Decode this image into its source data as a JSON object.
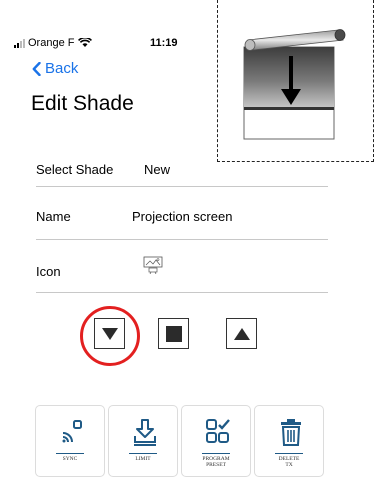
{
  "status_bar": {
    "carrier": "Orange F",
    "time": "11:19"
  },
  "nav": {
    "back_label": "Back"
  },
  "page_title": "Edit Shade",
  "form": {
    "select_shade": {
      "label": "Select Shade",
      "value": "New"
    },
    "name": {
      "label": "Name",
      "value": "Projection screen"
    },
    "icon": {
      "label": "Icon",
      "value_icon": "projection-screen-icon"
    }
  },
  "controls": {
    "down": "down-arrow-icon",
    "stop": "stop-square-icon",
    "up": "up-arrow-icon",
    "highlight_color": "#e32020"
  },
  "actions": [
    {
      "label": "SYNC",
      "icon": "sync-signal-icon"
    },
    {
      "label": "LIMIT",
      "icon": "limit-download-icon"
    },
    {
      "label1": "PROGRAM",
      "label2": "PRESET",
      "icon": "program-preset-icon"
    },
    {
      "label1": "DELETE",
      "label2": "TX",
      "icon": "trash-icon"
    }
  ],
  "colors": {
    "accent": "#1a73e8",
    "tile_icon": "#1f5a86"
  }
}
